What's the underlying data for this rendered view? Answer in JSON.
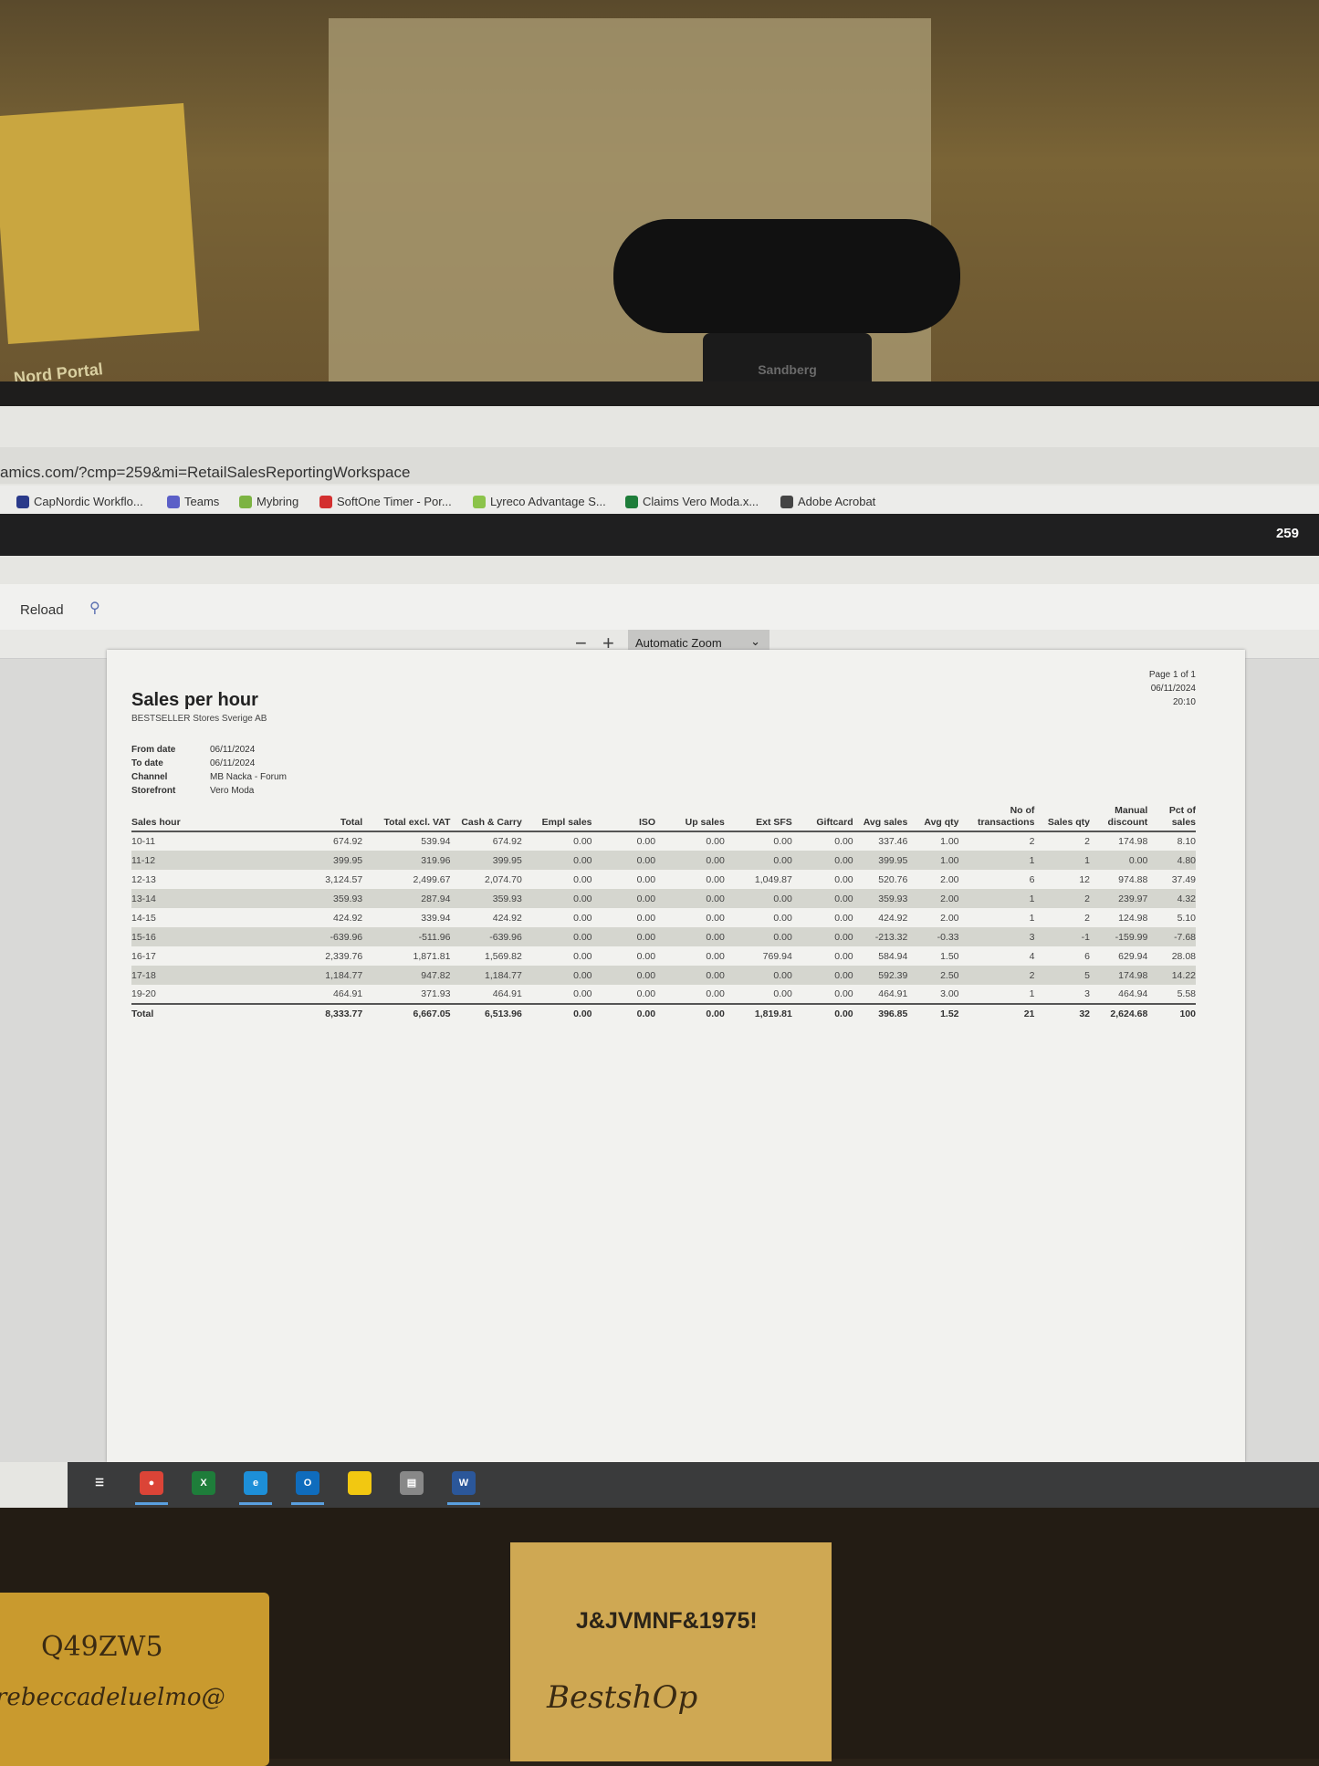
{
  "background": {
    "wall_sign": "...Nord Portal",
    "webcam_brand": "Sandberg"
  },
  "browser": {
    "url": "amics.com/?cmp=259&mi=RetailSalesReportingWorkspace",
    "bookmarks": [
      {
        "label": "CapNordic Workflo...",
        "icon": "capnordic-icon",
        "color": "#2a3a8a"
      },
      {
        "label": "Teams",
        "icon": "teams-icon",
        "color": "#5b5fc7"
      },
      {
        "label": "Mybring",
        "icon": "mybring-icon",
        "color": "#7cb342"
      },
      {
        "label": "SoftOne Timer - Por...",
        "icon": "softone-icon",
        "color": "#d32f2f"
      },
      {
        "label": "Lyreco Advantage S...",
        "icon": "lyreco-icon",
        "color": "#8bc34a"
      },
      {
        "label": "Claims Vero Moda.x...",
        "icon": "excel-icon",
        "color": "#1e7d3a"
      },
      {
        "label": "Adobe Acrobat",
        "icon": "globe-icon",
        "color": "#444444"
      }
    ],
    "company_code": "259",
    "reload_label": "Reload",
    "zoom_select": "Automatic Zoom"
  },
  "report": {
    "title": "Sales per hour",
    "company": "BESTSELLER Stores Sverige AB",
    "page": "Page 1 of 1",
    "print_date": "06/11/2024",
    "print_time": "20:10",
    "meta": [
      {
        "label": "From date",
        "value": "06/11/2024"
      },
      {
        "label": "To date",
        "value": "06/11/2024"
      },
      {
        "label": "Channel",
        "value": "MB Nacka - Forum"
      },
      {
        "label": "Storefront",
        "value": "Vero Moda"
      }
    ],
    "columns": [
      [
        "",
        "Sales hour"
      ],
      [
        "",
        "Total"
      ],
      [
        "",
        "Total excl. VAT"
      ],
      [
        "",
        "Cash & Carry"
      ],
      [
        "",
        "Empl sales"
      ],
      [
        "",
        "ISO"
      ],
      [
        "",
        "Up sales"
      ],
      [
        "",
        "Ext SFS"
      ],
      [
        "",
        "Giftcard"
      ],
      [
        "",
        "Avg sales"
      ],
      [
        "",
        "Avg qty"
      ],
      [
        "No of",
        "transactions"
      ],
      [
        "",
        "Sales qty"
      ],
      [
        "Manual",
        "discount"
      ],
      [
        "Pct of",
        "sales"
      ]
    ],
    "rows": [
      [
        "10-11",
        "674.92",
        "539.94",
        "674.92",
        "0.00",
        "0.00",
        "0.00",
        "0.00",
        "0.00",
        "337.46",
        "1.00",
        "2",
        "2",
        "174.98",
        "8.10"
      ],
      [
        "11-12",
        "399.95",
        "319.96",
        "399.95",
        "0.00",
        "0.00",
        "0.00",
        "0.00",
        "0.00",
        "399.95",
        "1.00",
        "1",
        "1",
        "0.00",
        "4.80"
      ],
      [
        "12-13",
        "3,124.57",
        "2,499.67",
        "2,074.70",
        "0.00",
        "0.00",
        "0.00",
        "1,049.87",
        "0.00",
        "520.76",
        "2.00",
        "6",
        "12",
        "974.88",
        "37.49"
      ],
      [
        "13-14",
        "359.93",
        "287.94",
        "359.93",
        "0.00",
        "0.00",
        "0.00",
        "0.00",
        "0.00",
        "359.93",
        "2.00",
        "1",
        "2",
        "239.97",
        "4.32"
      ],
      [
        "14-15",
        "424.92",
        "339.94",
        "424.92",
        "0.00",
        "0.00",
        "0.00",
        "0.00",
        "0.00",
        "424.92",
        "2.00",
        "1",
        "2",
        "124.98",
        "5.10"
      ],
      [
        "15-16",
        "-639.96",
        "-511.96",
        "-639.96",
        "0.00",
        "0.00",
        "0.00",
        "0.00",
        "0.00",
        "-213.32",
        "-0.33",
        "3",
        "-1",
        "-159.99",
        "-7.68"
      ],
      [
        "16-17",
        "2,339.76",
        "1,871.81",
        "1,569.82",
        "0.00",
        "0.00",
        "0.00",
        "769.94",
        "0.00",
        "584.94",
        "1.50",
        "4",
        "6",
        "629.94",
        "28.08"
      ],
      [
        "17-18",
        "1,184.77",
        "947.82",
        "1,184.77",
        "0.00",
        "0.00",
        "0.00",
        "0.00",
        "0.00",
        "592.39",
        "2.50",
        "2",
        "5",
        "174.98",
        "14.22"
      ],
      [
        "19-20",
        "464.91",
        "371.93",
        "464.91",
        "0.00",
        "0.00",
        "0.00",
        "0.00",
        "0.00",
        "464.91",
        "3.00",
        "1",
        "3",
        "464.94",
        "5.58"
      ]
    ],
    "total": [
      "Total",
      "8,333.77",
      "6,667.05",
      "6,513.96",
      "0.00",
      "0.00",
      "0.00",
      "1,819.81",
      "0.00",
      "396.85",
      "1.52",
      "21",
      "32",
      "2,624.68",
      "100"
    ]
  },
  "taskbar": [
    {
      "icon": "task-view-icon",
      "color": "#3a3b3c",
      "glyph": "☰",
      "active": false
    },
    {
      "icon": "chrome-icon",
      "color": "#db4437",
      "glyph": "●",
      "active": true
    },
    {
      "icon": "excel-icon",
      "color": "#1e7d3a",
      "glyph": "X",
      "active": false
    },
    {
      "icon": "edge-icon",
      "color": "#1d8fd8",
      "glyph": "e",
      "active": true
    },
    {
      "icon": "outlook-icon",
      "color": "#0f6cbd",
      "glyph": "O",
      "active": true
    },
    {
      "icon": "sticky-notes-icon",
      "color": "#f2c811",
      "glyph": "",
      "active": false
    },
    {
      "icon": "printer-app-icon",
      "color": "#888888",
      "glyph": "▤",
      "active": false
    },
    {
      "icon": "word-icon",
      "color": "#2b579a",
      "glyph": "W",
      "active": true
    }
  ],
  "sticky_notes": {
    "left_line1": "Q49ZW5",
    "left_line2": "rebeccadeluelmo@",
    "right_printed": "J&JVMNF&1975!",
    "right_handwritten": "BestshOp"
  }
}
